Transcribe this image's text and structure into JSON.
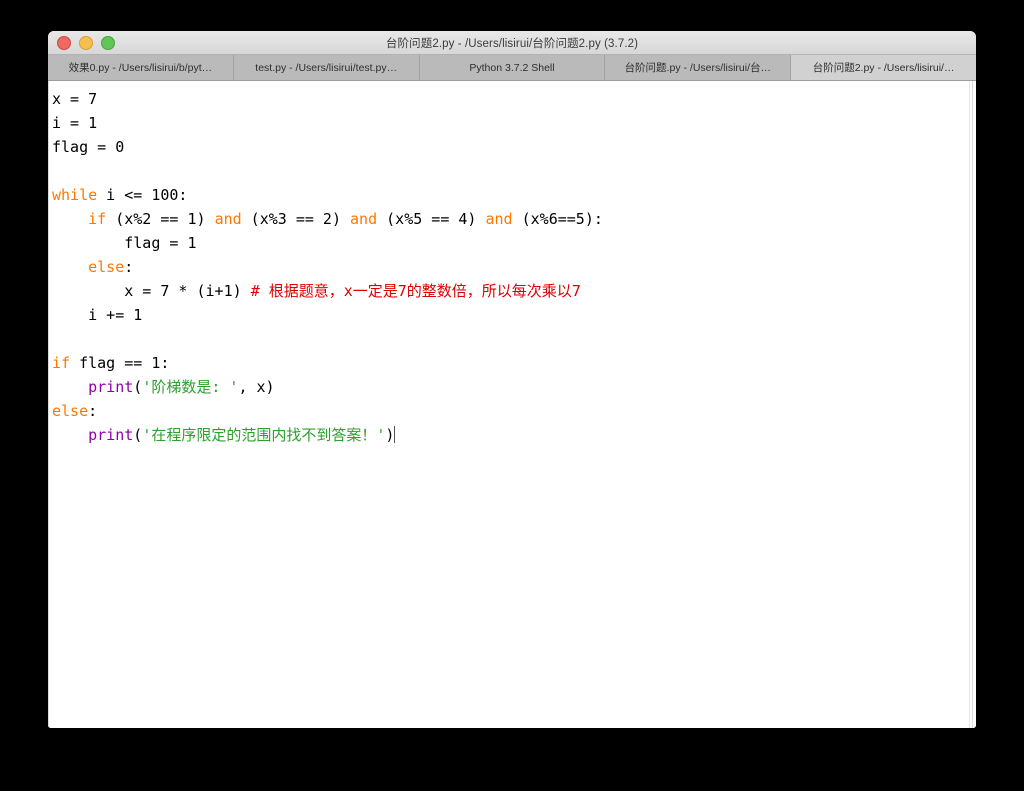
{
  "window": {
    "title": "台阶问题2.py - /Users/lisirui/台阶问题2.py (3.7.2)",
    "traffic_lights": {
      "close": "close-button",
      "minimize": "minimize-button",
      "maximize": "maximize-button"
    },
    "colors": {
      "keyword": "#ff7700",
      "builtin": "#9000a8",
      "string": "#2ca02c",
      "comment": "#dd0000",
      "text": "#000000",
      "editor_background": "#ffffff",
      "titlebar_background": "#e0dfdf",
      "tabbar_background": "#bbbaba",
      "active_tab_background": "#d2d1d1",
      "desktop_background": "#000000"
    }
  },
  "tabs": [
    {
      "label": "效果0.py - /Users/lisirui/b/pyt…",
      "active": false
    },
    {
      "label": "test.py - /Users/lisirui/test.py…",
      "active": false
    },
    {
      "label": "Python 3.7.2 Shell",
      "active": false
    },
    {
      "label": "台阶问题.py - /Users/lisirui/台…",
      "active": false
    },
    {
      "label": "台阶问题2.py - /Users/lisirui/…",
      "active": true
    }
  ],
  "editor": {
    "language": "python",
    "lines": [
      [
        {
          "t": "x = 7",
          "c": "plain"
        }
      ],
      [
        {
          "t": "i = 1",
          "c": "plain"
        }
      ],
      [
        {
          "t": "flag = 0",
          "c": "plain"
        }
      ],
      [],
      [
        {
          "t": "while",
          "c": "kw"
        },
        {
          "t": " i <= 100:",
          "c": "plain"
        }
      ],
      [
        {
          "t": "    ",
          "c": "plain"
        },
        {
          "t": "if",
          "c": "kw"
        },
        {
          "t": " (x%2 == 1) ",
          "c": "plain"
        },
        {
          "t": "and",
          "c": "kw"
        },
        {
          "t": " (x%3 == 2) ",
          "c": "plain"
        },
        {
          "t": "and",
          "c": "kw"
        },
        {
          "t": " (x%5 == 4) ",
          "c": "plain"
        },
        {
          "t": "and",
          "c": "kw"
        },
        {
          "t": " (x%6==5):",
          "c": "plain"
        }
      ],
      [
        {
          "t": "        flag = 1",
          "c": "plain"
        }
      ],
      [
        {
          "t": "    ",
          "c": "plain"
        },
        {
          "t": "else",
          "c": "kw"
        },
        {
          "t": ":",
          "c": "plain"
        }
      ],
      [
        {
          "t": "        x = 7 * (i+1) ",
          "c": "plain"
        },
        {
          "t": "# 根据题意，x一定是7的整数倍，所以每次乘以7",
          "c": "cmt"
        }
      ],
      [
        {
          "t": "    i += 1",
          "c": "plain"
        }
      ],
      [],
      [
        {
          "t": "if",
          "c": "kw"
        },
        {
          "t": " flag == 1:",
          "c": "plain"
        }
      ],
      [
        {
          "t": "    ",
          "c": "plain"
        },
        {
          "t": "print",
          "c": "bi"
        },
        {
          "t": "(",
          "c": "plain"
        },
        {
          "t": "'阶梯数是: '",
          "c": "str"
        },
        {
          "t": ", x)",
          "c": "plain"
        }
      ],
      [
        {
          "t": "else",
          "c": "kw"
        },
        {
          "t": ":",
          "c": "plain"
        }
      ],
      [
        {
          "t": "    ",
          "c": "plain"
        },
        {
          "t": "print",
          "c": "bi"
        },
        {
          "t": "(",
          "c": "plain"
        },
        {
          "t": "'在程序限定的范围内找不到答案！'",
          "c": "str"
        },
        {
          "t": ")",
          "c": "plain"
        },
        {
          "t": "",
          "c": "caret"
        }
      ]
    ]
  }
}
